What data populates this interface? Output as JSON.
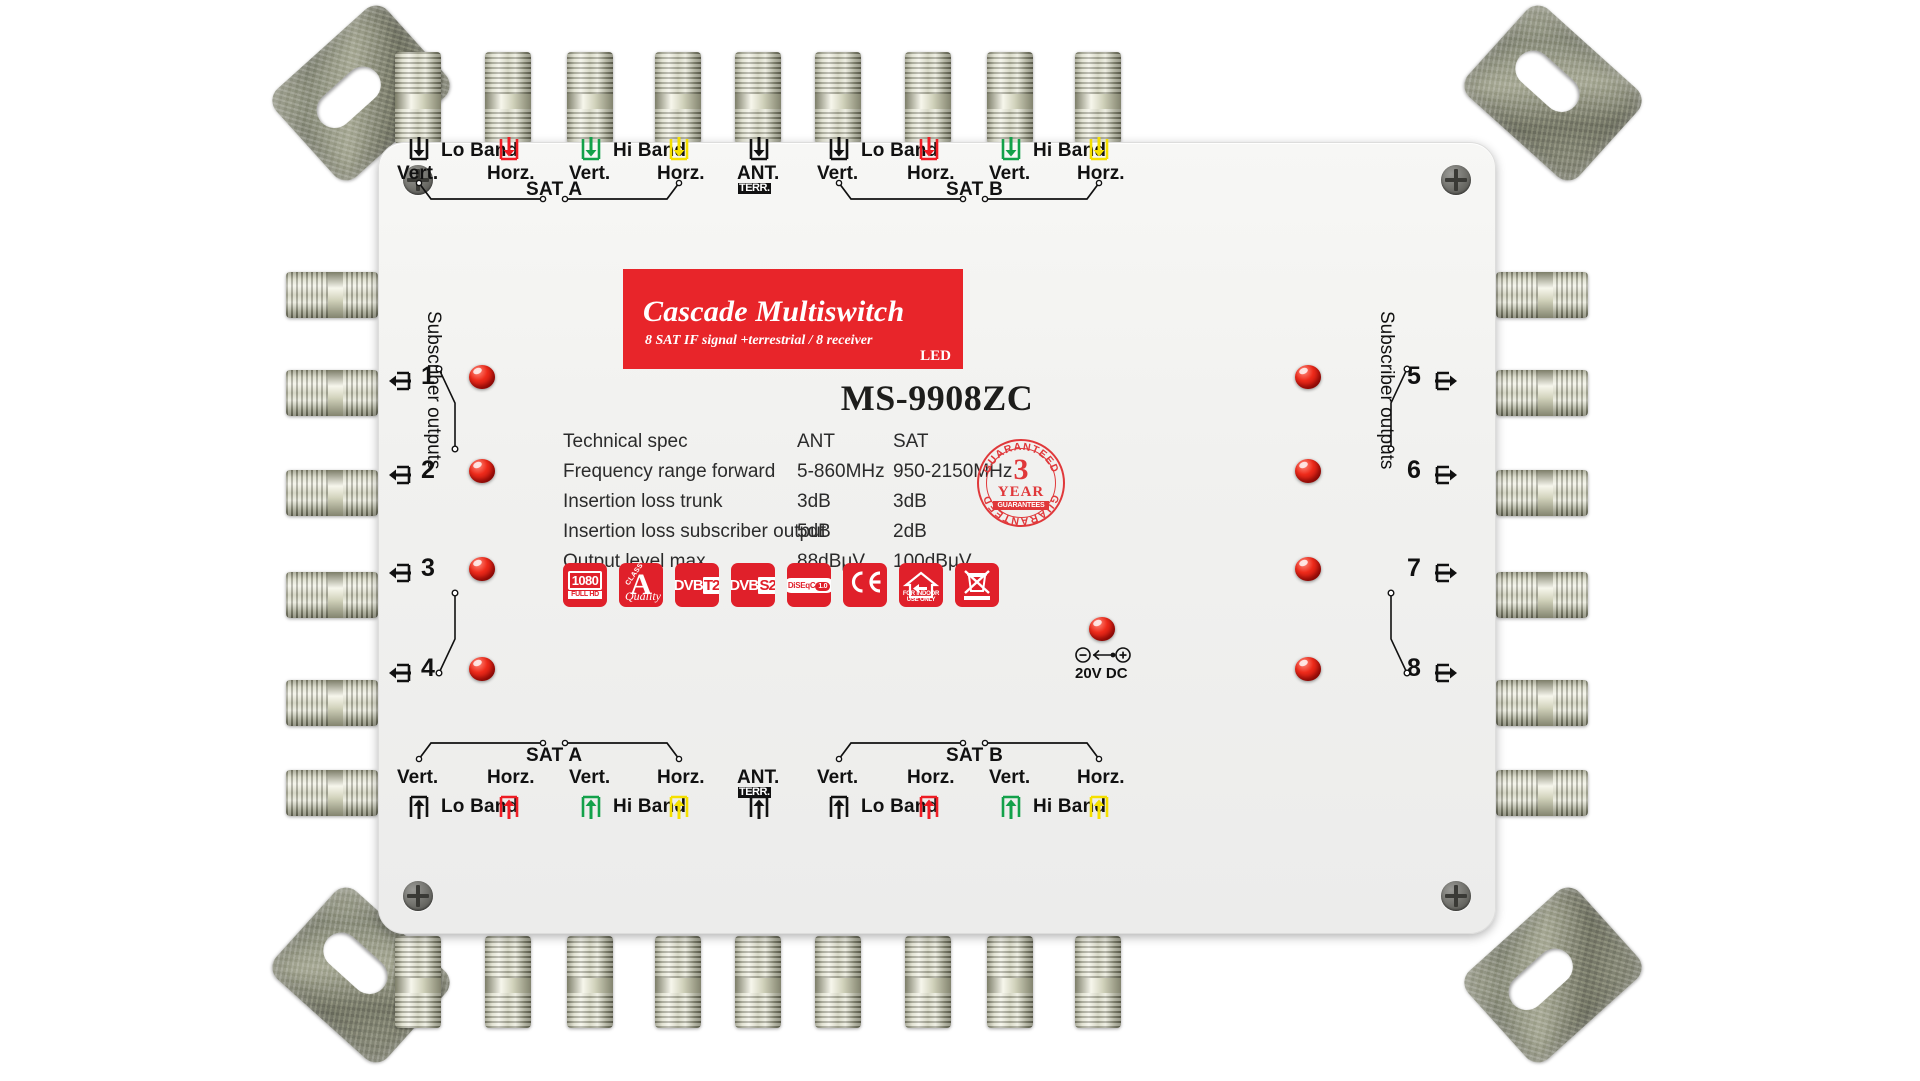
{
  "device": {
    "model": "MS-9908ZC",
    "nameplate": {
      "title": "Cascade Multiswitch",
      "subtitle": "8 SAT IF signal +terrestrial / 8 receiver",
      "led_label": "LED",
      "background_color": "#e8252a"
    }
  },
  "top_row": {
    "groups": [
      {
        "sat_label": "SAT A",
        "ports": [
          {
            "band": "Lo Band",
            "polarity": "Vert.",
            "arrow_color": "#111111"
          },
          {
            "band": "Lo Band",
            "polarity": "Horz.",
            "arrow_color": "#ee1c24"
          },
          {
            "band": "Hi Band",
            "polarity": "Vert.",
            "arrow_color": "#13a14a"
          },
          {
            "band": "Hi Band",
            "polarity": "Horz.",
            "arrow_color": "#f5e000"
          }
        ]
      },
      {
        "sat_label": "SAT B",
        "ports": [
          {
            "band": "Lo Band",
            "polarity": "Vert.",
            "arrow_color": "#111111"
          },
          {
            "band": "Lo Band",
            "polarity": "Horz.",
            "arrow_color": "#ee1c24"
          },
          {
            "band": "Hi Band",
            "polarity": "Vert.",
            "arrow_color": "#13a14a"
          },
          {
            "band": "Hi Band",
            "polarity": "Horz.",
            "arrow_color": "#f5e000"
          }
        ]
      }
    ],
    "antenna": {
      "label": "ANT.",
      "sub_label": "TERR.",
      "arrow_color": "#111111"
    }
  },
  "bottom_row": {
    "groups": [
      {
        "sat_label": "SAT A",
        "ports": [
          {
            "band": "Lo Band",
            "polarity": "Vert.",
            "arrow_color": "#111111"
          },
          {
            "band": "Lo Band",
            "polarity": "Horz.",
            "arrow_color": "#ee1c24"
          },
          {
            "band": "Hi Band",
            "polarity": "Vert.",
            "arrow_color": "#13a14a"
          },
          {
            "band": "Hi Band",
            "polarity": "Horz.",
            "arrow_color": "#f5e000"
          }
        ]
      },
      {
        "sat_label": "SAT B",
        "ports": [
          {
            "band": "Lo Band",
            "polarity": "Vert.",
            "arrow_color": "#111111"
          },
          {
            "band": "Lo Band",
            "polarity": "Horz.",
            "arrow_color": "#ee1c24"
          },
          {
            "band": "Hi Band",
            "polarity": "Vert.",
            "arrow_color": "#13a14a"
          },
          {
            "band": "Hi Band",
            "polarity": "Horz.",
            "arrow_color": "#f5e000"
          }
        ]
      }
    ],
    "antenna": {
      "label": "ANT.",
      "sub_label": "TERR.",
      "arrow_color": "#111111"
    }
  },
  "subscriber_outputs": {
    "left": {
      "caption": "Subscriber outputs",
      "numbers": [
        "1",
        "2",
        "3",
        "4"
      ]
    },
    "right": {
      "caption": "Subscriber outputs",
      "numbers": [
        "5",
        "6",
        "7",
        "8"
      ]
    }
  },
  "power": {
    "label": "20V DC"
  },
  "spec": {
    "header": {
      "name": "Technical spec",
      "ant": "ANT",
      "sat": "SAT"
    },
    "rows": [
      {
        "name": "Frequency range forward",
        "ant": "5-860MHz",
        "sat": "950-2150MHz"
      },
      {
        "name": "Insertion loss trunk",
        "ant": "3dB",
        "sat": "3dB"
      },
      {
        "name": "Insertion loss subscriber output",
        "ant": "5dB",
        "sat": "2dB"
      },
      {
        "name": "Output level max",
        "ant": "88dBμV",
        "sat": "100dBμV"
      }
    ]
  },
  "seal": {
    "arc_top": "GUARANTEED",
    "arc_bottom": "GUARANTEED",
    "number": "3",
    "year": "YEAR",
    "ribbon": "GUARANTEES"
  },
  "badges": [
    {
      "id": "badge-1080-full-hd",
      "line1": "1080",
      "line2": "FULL HD"
    },
    {
      "id": "badge-a-class-quality",
      "letter": "A",
      "class_text": "CLASS",
      "quality_text": "Quality"
    },
    {
      "id": "badge-dvb-t2",
      "text": "DVB",
      "suffix": "T2"
    },
    {
      "id": "badge-dvb-s2",
      "text": "DVB",
      "suffix": "S2"
    },
    {
      "id": "badge-diseqc",
      "text": "DiSEqC",
      "version": "1.0"
    },
    {
      "id": "badge-ce",
      "text": "CE"
    },
    {
      "id": "badge-indoor-use-only",
      "caption": "FOR INDOOR USE ONLY"
    },
    {
      "id": "badge-weee",
      "caption": ""
    }
  ]
}
